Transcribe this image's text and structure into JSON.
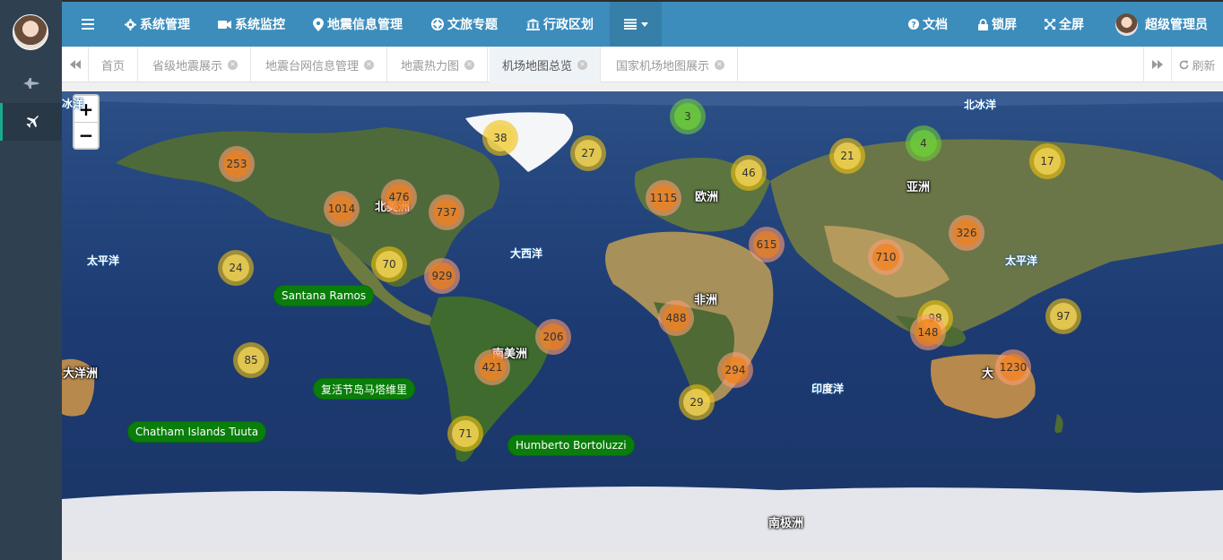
{
  "topbar": {
    "menu": [
      {
        "label": "系统管理",
        "icon": "gear-icon"
      },
      {
        "label": "系统监控",
        "icon": "video-camera-icon"
      },
      {
        "label": "地震信息管理",
        "icon": "map-pin-icon"
      },
      {
        "label": "文旅专题",
        "icon": "life-ring-icon"
      },
      {
        "label": "行政区划",
        "icon": "bank-icon"
      }
    ],
    "right": [
      {
        "label": "文档",
        "icon": "question-circle-icon"
      },
      {
        "label": "锁屏",
        "icon": "lock-icon"
      },
      {
        "label": "全屏",
        "icon": "expand-icon"
      }
    ],
    "user_name": "超级管理员"
  },
  "tabs": [
    {
      "label": "首页",
      "closable": false,
      "active": false
    },
    {
      "label": "省级地震展示",
      "closable": true,
      "active": false
    },
    {
      "label": "地震台网信息管理",
      "closable": true,
      "active": false
    },
    {
      "label": "地震热力图",
      "closable": true,
      "active": false
    },
    {
      "label": "机场地图总览",
      "closable": true,
      "active": true
    },
    {
      "label": "国家机场地图展示",
      "closable": true,
      "active": false
    }
  ],
  "refresh_label": "刷新",
  "map": {
    "zoom_in": "+",
    "zoom_out": "−",
    "clusters": [
      "3",
      "38",
      "27",
      "253",
      "476",
      "1014",
      "737",
      "1115",
      "46",
      "21",
      "4",
      "17",
      "615",
      "326",
      "710",
      "24",
      "70",
      "929",
      "488",
      "206",
      "421",
      "294",
      "29",
      "98",
      "148",
      "97",
      "1230",
      "85",
      "71"
    ],
    "place_labels": [
      "北美洲",
      "欧洲",
      "亚洲",
      "非洲",
      "南美洲",
      "大洋洲",
      "南极洲",
      "大"
    ],
    "ocean_labels": [
      "北冰洋",
      "太平洋",
      "大西洋",
      "太平洋",
      "印度洋",
      "冰洋"
    ],
    "airports": [
      "Santana Ramos",
      "复活节岛马塔维里",
      "Chatham Islands Tuuta",
      "Humberto Bortoluzzi"
    ]
  },
  "colors": {
    "topbar": "#3c8dbc",
    "sidebar": "#2f4050",
    "cluster_green": "#6ecc39",
    "cluster_yellow": "#f0c20c",
    "cluster_orange": "#f18017",
    "airport_label": "#0a7d0a"
  }
}
